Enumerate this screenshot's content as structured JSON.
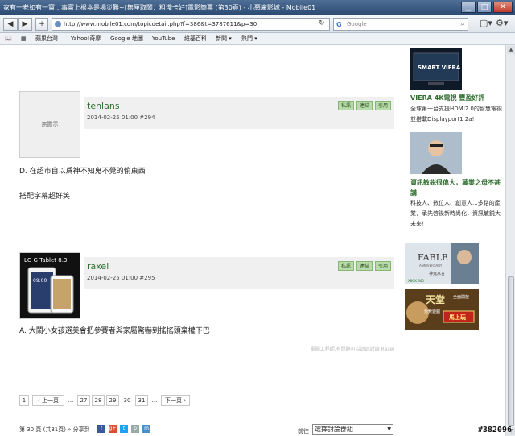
{
  "window": {
    "title": "家有一老如有一寶…事實上根本是場災難~[無厘取鬧：粗淺卡好]電影簡票 (第30頁) - 小惡魔影城 - Mobile01",
    "minimize": "▁",
    "maximize": "□",
    "close": "✕"
  },
  "nav": {
    "back": "◀",
    "forward": "▶",
    "add": "+",
    "url": "http://www.mobile01.com/topicdetail.php?f=386&t=3787611&p=30",
    "reload": "↻",
    "search_placeholder": "Google",
    "search_engine_icon": "G",
    "search_button": "⌕",
    "page_menu": "▢▾",
    "tools_menu": "⚙▾"
  },
  "bookmarks": {
    "book_icon": "📖",
    "grid_icon": "▦",
    "items": [
      "蘋果台灣",
      "Yahoo!奇摩",
      "Google 地圖",
      "YouTube",
      "維基百科",
      "新聞 ▾",
      "熱門 ▾"
    ]
  },
  "posts": [
    {
      "avatar_text": "無圖示",
      "author": "tenlans",
      "meta": "2014-02-25 01:00  #294",
      "actions": [
        "私訊",
        "連結",
        "引用"
      ],
      "lines": [
        "D. 在超市自以爲神不知鬼不覺的偷東西",
        "搭配字幕超好笑"
      ]
    },
    {
      "avatar_text": "LG G Tablet 8.3",
      "avatar_clock": "09:00",
      "author": "raxel",
      "meta": "2014-02-25 01:00  #295",
      "actions": [
        "私訊",
        "連結",
        "引用"
      ],
      "lines": [
        "A. 大鬧小女孩選美會把參賽者與家屬驚嚇到搖搖頭棄權下巴"
      ],
      "signature": "電腦工程師.有問題可以說說討論 Raxel"
    }
  ],
  "pager": {
    "first": "1",
    "prev": "‹ 上一頁",
    "dots1": "...",
    "pages": [
      "27",
      "28",
      "29",
      "30",
      "31"
    ],
    "current": "30",
    "dots2": "...",
    "next": "下一頁 ›"
  },
  "footer": {
    "page_info": "第 30 頁 (共31頁) » 分享到",
    "share_icons": [
      "f",
      "g+",
      "t",
      "p",
      "m"
    ],
    "goto_label": "前往",
    "goto_value": "選擇討論群組"
  },
  "sidebar": {
    "items": [
      {
        "title": "VIERA 4K電視 豐盈好評",
        "desc": "全球第一台支援HDMI2.0的智慧電視並搭載Displayport1.2a!",
        "thumb_text": "SMART VIERA"
      },
      {
        "title": "資訊敏鋭很偉大，萬業之母不甚講",
        "desc": "科技人、數位人、創意人...多路的產業，承先啓後新時尚化，資訊敏鋭大未來！"
      }
    ],
    "ad1": {
      "title": "FABLE",
      "sub": "ANNIVERSARY",
      "cn": "神鬼寓言",
      "badge": "XBOX 360"
    },
    "ad2": {
      "title": "天堂",
      "sub": "全面開放",
      "button": "馬上玩",
      "tag": "免費遊戲"
    }
  },
  "watermark": "#382096",
  "colors": {
    "accent_green": "#2f6e2f",
    "action_green": "#b8dca8",
    "titlebar": "#2b4a72"
  }
}
